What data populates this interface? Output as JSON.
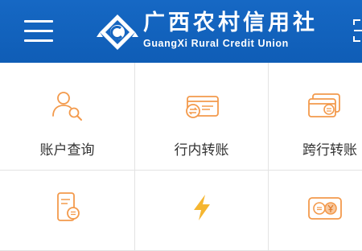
{
  "header": {
    "brand_cn": "广西农村信用社",
    "brand_en": "GuangXi Rural Credit Union",
    "menu_icon": "hamburger-menu-icon",
    "scan_icon": "scan-icon",
    "background_color": "#1565c0"
  },
  "menu": {
    "accent_color": "#f39a4c",
    "items": [
      {
        "label": "账户查询",
        "icon": "account-query-icon"
      },
      {
        "label": "行内转账",
        "icon": "card-transfer-icon"
      },
      {
        "label": "跨行转账",
        "icon": "interbank-transfer-icon"
      },
      {
        "label": "",
        "icon": "phone-transfer-icon"
      },
      {
        "label": "",
        "icon": "lightning-icon"
      },
      {
        "label": "",
        "icon": "currency-exchange-icon"
      }
    ]
  }
}
